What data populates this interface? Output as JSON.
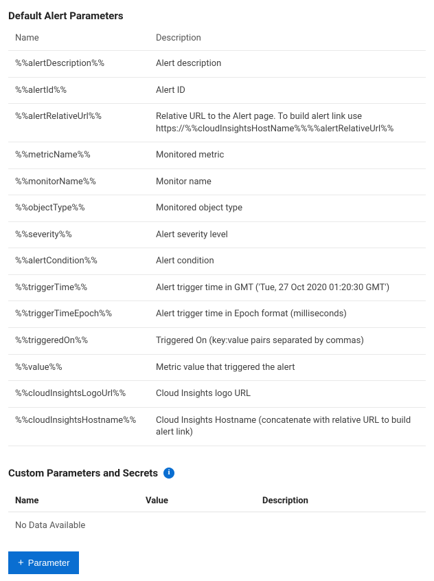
{
  "defaultSection": {
    "title": "Default Alert Parameters",
    "columns": {
      "name": "Name",
      "description": "Description"
    },
    "rows": [
      {
        "name": "%%alertDescription%%",
        "description": "Alert description"
      },
      {
        "name": "%%alertId%%",
        "description": "Alert ID"
      },
      {
        "name": "%%alertRelativeUrl%%",
        "description": "Relative URL to the Alert page. To build alert link use https://%%cloudInsightsHostName%%%%alertRelativeUrl%%"
      },
      {
        "name": "%%metricName%%",
        "description": "Monitored metric"
      },
      {
        "name": "%%monitorName%%",
        "description": "Monitor name"
      },
      {
        "name": "%%objectType%%",
        "description": "Monitored object type"
      },
      {
        "name": "%%severity%%",
        "description": "Alert severity level"
      },
      {
        "name": "%%alertCondition%%",
        "description": "Alert condition"
      },
      {
        "name": "%%triggerTime%%",
        "description": "Alert trigger time in GMT ('Tue, 27 Oct 2020 01:20:30 GMT')"
      },
      {
        "name": "%%triggerTimeEpoch%%",
        "description": "Alert trigger time in Epoch format (milliseconds)"
      },
      {
        "name": "%%triggeredOn%%",
        "description": "Triggered On (key:value pairs separated by commas)"
      },
      {
        "name": "%%value%%",
        "description": "Metric value that triggered the alert"
      },
      {
        "name": "%%cloudInsightsLogoUrl%%",
        "description": "Cloud Insights logo URL"
      },
      {
        "name": "%%cloudInsightsHostname%%",
        "description": "Cloud Insights Hostname (concatenate with relative URL to build alert link)"
      }
    ]
  },
  "customSection": {
    "title": "Custom Parameters and Secrets",
    "columns": {
      "name": "Name",
      "value": "Value",
      "description": "Description"
    },
    "empty": "No Data Available",
    "addButton": "Parameter"
  }
}
